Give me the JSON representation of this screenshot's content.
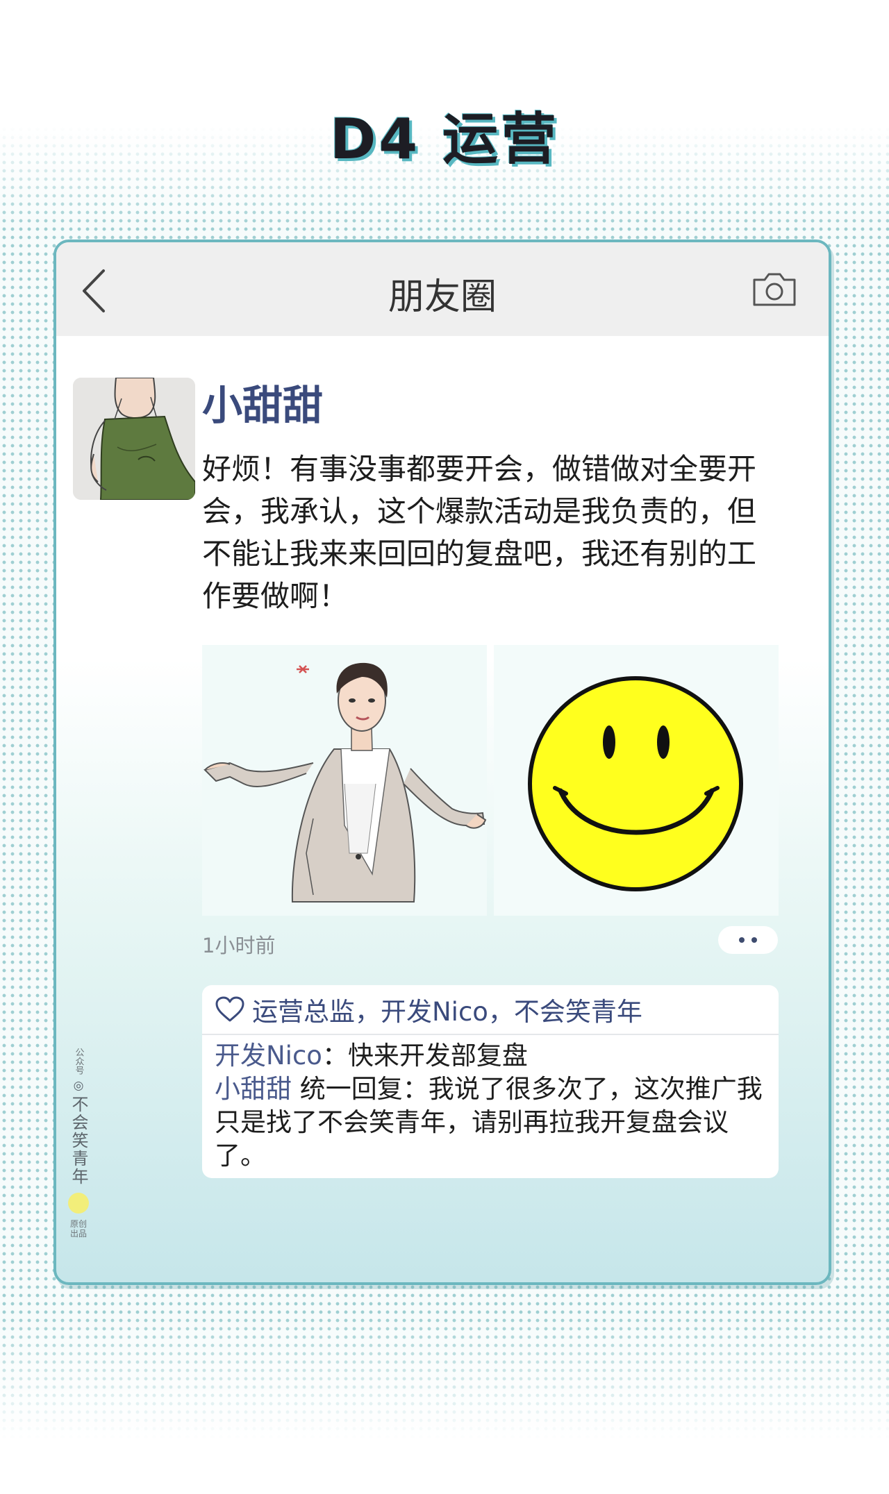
{
  "header": {
    "title": "D4 运营"
  },
  "nav": {
    "title": "朋友圈",
    "back_icon": "chevron-left-icon",
    "camera_icon": "camera-icon"
  },
  "post": {
    "username": "小甜甜",
    "text": "好烦！有事没事都要开会，做错做对全要开会，我承认，这个爆款活动是我负责的，但不能让我来来回回的复盘吧，我还有别的工作要做啊！",
    "timestamp": "1小时前",
    "images": [
      "woman-shrugging-illustration",
      "yellow-smiley-face"
    ]
  },
  "likes": {
    "icon": "heart-icon",
    "text": "运营总监，开发Nico，不会笑青年"
  },
  "comments": [
    {
      "author": "开发Nico",
      "separator": "：",
      "text": "快来开发部复盘"
    },
    {
      "author": "小甜甜",
      "separator": " ",
      "text": "统一回复：我说了很多次了，这次推广我只是找了不会笑青年，请别再拉我开复盘会议了。"
    }
  ],
  "watermark": {
    "top": "公众号",
    "logo": "◎",
    "name": "不会笑青年",
    "bottom": "原创出品"
  },
  "colors": {
    "accent": "#57b7c1",
    "name_blue": "#3a4a7c",
    "frame": "#6cb7bf"
  }
}
